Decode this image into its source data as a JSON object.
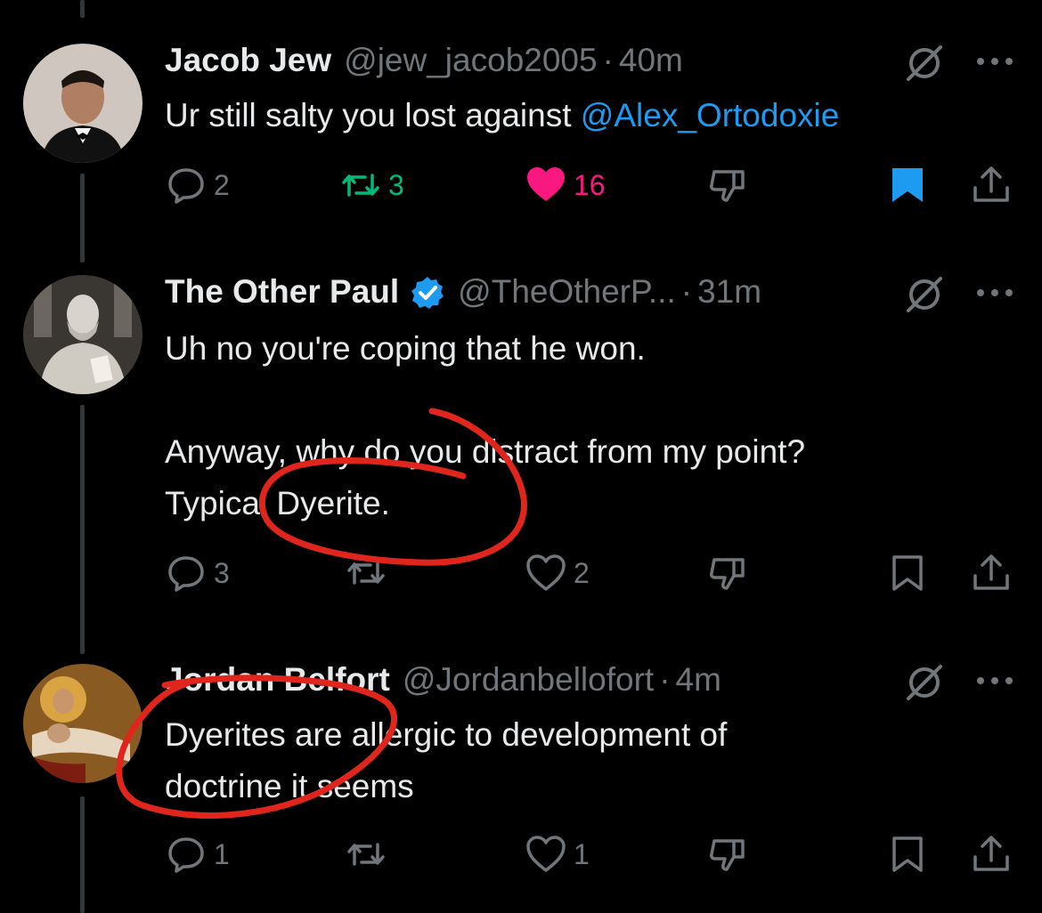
{
  "tweets": [
    {
      "name": "Jacob Jew",
      "handle": "@jew_jacob2005",
      "time": "40m",
      "text_pre": "Ur still salty you lost against ",
      "mention": "@Alex_Ortodoxie",
      "replies": "2",
      "retweets": "3",
      "likes": "16",
      "bookmarked": true,
      "liked": true,
      "retweeted": true
    },
    {
      "name": "The Other Paul",
      "verified": true,
      "handle": "@TheOtherP...",
      "time": "31m",
      "text": "Uh no you're coping that he won.\n\nAnyway, why do you distract from my point?\nTypical Dyerite.",
      "replies": "3",
      "retweets": "",
      "likes": "2"
    },
    {
      "name": "Jordan Belfort",
      "handle": "@Jordanbellofort",
      "time": "4m",
      "text": "Dyerites are allergic to development of\ndoctrine it seems",
      "replies": "1",
      "retweets": "",
      "likes": "1"
    }
  ],
  "separator": "·",
  "colors": {
    "background": "#000000",
    "text": "#e7e9ea",
    "muted": "#71767b",
    "accent": "#1d9bf0",
    "like": "#f91880",
    "retweet": "#00ba7c",
    "annotation": "#e0261c"
  },
  "icons": [
    "reply-icon",
    "retweet-icon",
    "like-icon",
    "dislike-icon",
    "bookmark-icon",
    "share-icon",
    "grok-icon",
    "more-icon",
    "verified-icon"
  ]
}
